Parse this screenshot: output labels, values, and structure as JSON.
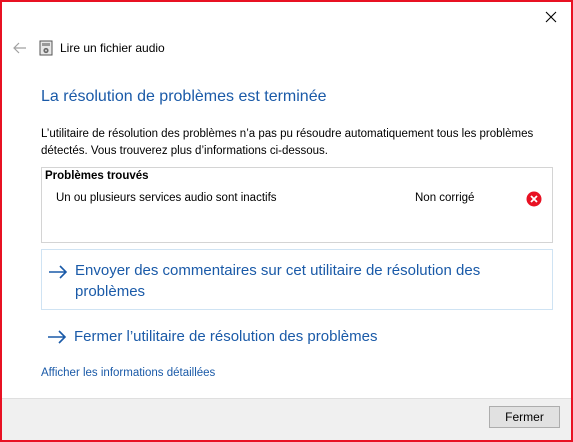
{
  "window": {
    "title": "Lire un fichier audio",
    "accent_color": "#e81123"
  },
  "icons": {
    "back": "arrow-left-icon",
    "app": "speaker-icon",
    "close": "close-icon",
    "status_error": "error-circle-icon",
    "link": "arrow-right-icon"
  },
  "content": {
    "heading": "La résolution de problèmes est terminée",
    "description": "L’utilitaire de résolution des problèmes n’a pas pu résoudre automatiquement tous les problèmes détectés. Vous trouverez plus d’informations ci-dessous.",
    "problems": {
      "title": "Problèmes trouvés",
      "items": [
        {
          "description": "Un ou plusieurs services audio sont inactifs",
          "status": "Non corrigé"
        }
      ]
    },
    "feedback_link": "Envoyer des commentaires sur cet utilitaire de résolution des problèmes",
    "close_link": "Fermer l’utilitaire de résolution des problèmes",
    "details_link": "Afficher les informations détaillées"
  },
  "footer": {
    "close_button": "Fermer"
  },
  "colors": {
    "link": "#1a5aa8",
    "error": "#e81123",
    "footer_bg": "#f0f0f0"
  }
}
